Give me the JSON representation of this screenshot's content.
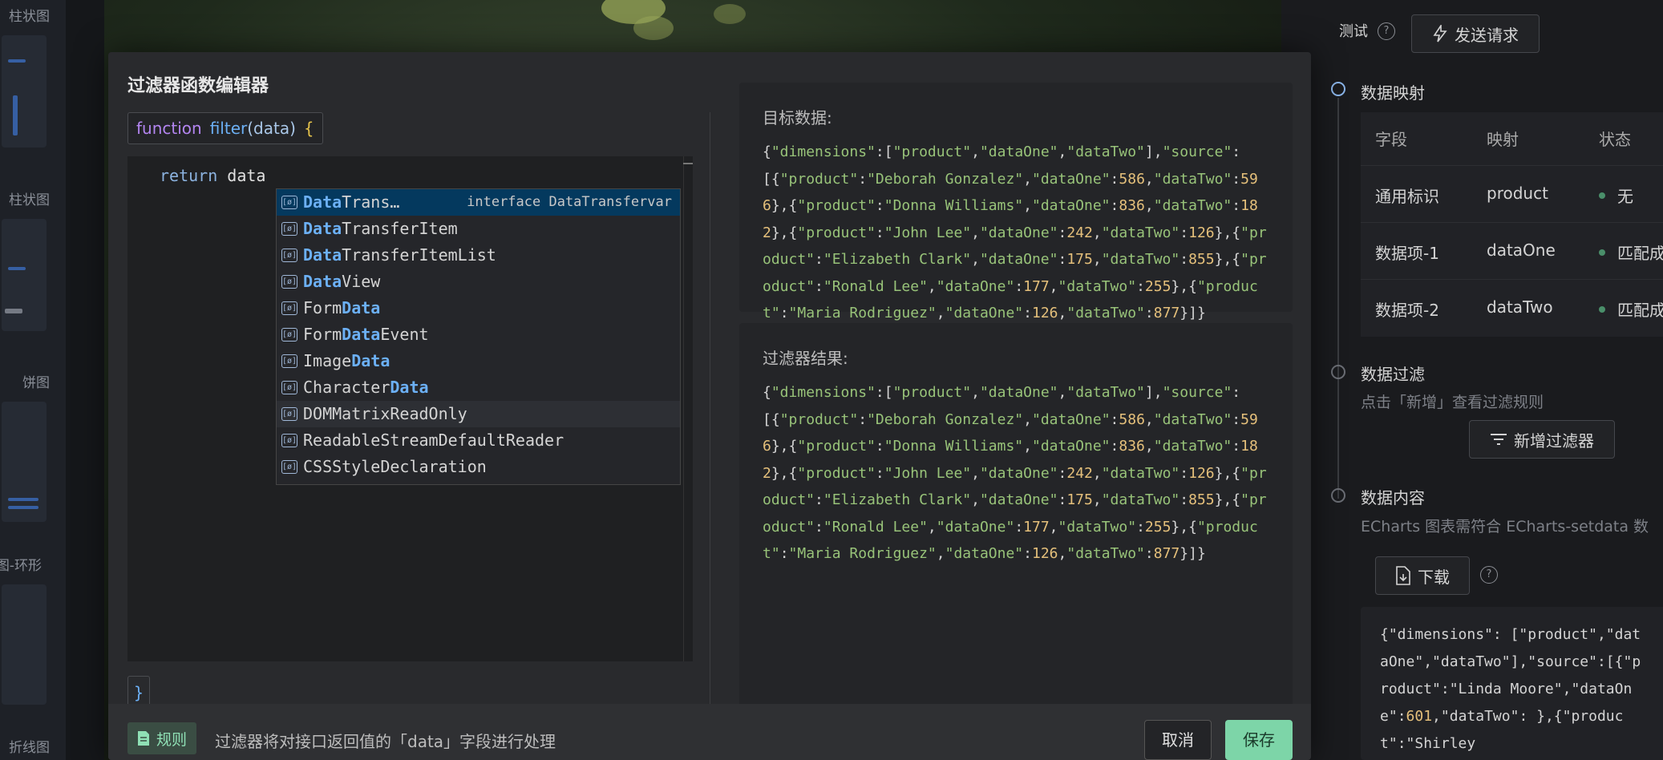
{
  "left_sidebar": {
    "items": [
      {
        "label": "柱状图"
      },
      {
        "label": "柱状图"
      },
      {
        "label": "饼图"
      },
      {
        "label": "图-环形"
      },
      {
        "label": "折线图"
      }
    ]
  },
  "modal": {
    "title": "过滤器函数编辑器",
    "function_header": {
      "keyword": "function",
      "name": "filter",
      "param": "(data)",
      "open_brace": "{"
    },
    "code": {
      "keyword": "return",
      "identifier": "data"
    },
    "close_brace": "}",
    "suggestions": [
      {
        "match": "Data",
        "rest": "Trans…",
        "detail": "interface DataTransfervar",
        "selected": true
      },
      {
        "match": "Data",
        "rest": "TransferItem"
      },
      {
        "match": "Data",
        "rest": "TransferItemList"
      },
      {
        "match": "Data",
        "rest": "View"
      },
      {
        "prefix": "Form",
        "match": "Data",
        "rest": ""
      },
      {
        "prefix": "Form",
        "match": "Data",
        "rest": "Event"
      },
      {
        "prefix": "Image",
        "match": "Data",
        "rest": ""
      },
      {
        "prefix": "Character",
        "match": "Data",
        "rest": ""
      },
      {
        "text": "DOMMatrixReadOnly"
      },
      {
        "text": "ReadableStreamDefaultReader"
      },
      {
        "text": "CSSStyleDeclaration"
      }
    ],
    "target_label": "目标数据:",
    "result_label": "过滤器结果:",
    "json_text": "{\"dimensions\":[\"product\",\"dataOne\",\"dataTwo\"],\"source\":[{\"product\":\"Deborah Gonzalez\",\"dataOne\":586,\"dataTwo\":596},{\"product\":\"Donna Williams\",\"dataOne\":836,\"dataTwo\":182},{\"product\":\"John Lee\",\"dataOne\":242,\"dataTwo\":126},{\"product\":\"Elizabeth Clark\",\"dataOne\":175,\"dataTwo\":855},{\"product\":\"Ronald Lee\",\"dataOne\":177,\"dataTwo\":255},{\"product\":\"Maria Rodriguez\",\"dataOne\":126,\"dataTwo\":877}]}",
    "footer": {
      "rule_tag": "规则",
      "rule_text": "过滤器将对接口返回值的「data」字段进行处理",
      "cancel": "取消",
      "save": "保存"
    }
  },
  "right_panel": {
    "test_label": "测试",
    "send_button": "发送请求",
    "mapping_title": "数据映射",
    "table": {
      "headers": [
        "字段",
        "映射",
        "状态"
      ],
      "rows": [
        {
          "field": "通用标识",
          "mapping": "product",
          "status": "无"
        },
        {
          "field": "数据项-1",
          "mapping": "dataOne",
          "status": "匹配成"
        },
        {
          "field": "数据项-2",
          "mapping": "dataTwo",
          "status": "匹配成"
        }
      ]
    },
    "filter_title": "数据过滤",
    "filter_hint": "点击「新增」查看过滤规则",
    "add_filter_button": "新增过滤器",
    "content_title": "数据内容",
    "content_hint": "ECharts 图表需符合 ECharts-setdata 数",
    "download_button": "下载",
    "data_code": "{\"dimensions\": [\"product\",\"dataOne\",\"dataTwo\"],\"source\":[{\"product\":\"Linda Moore\",\"dataOne\":601,\"dataTwo\": },{\"product\":\"Shirley"
  }
}
